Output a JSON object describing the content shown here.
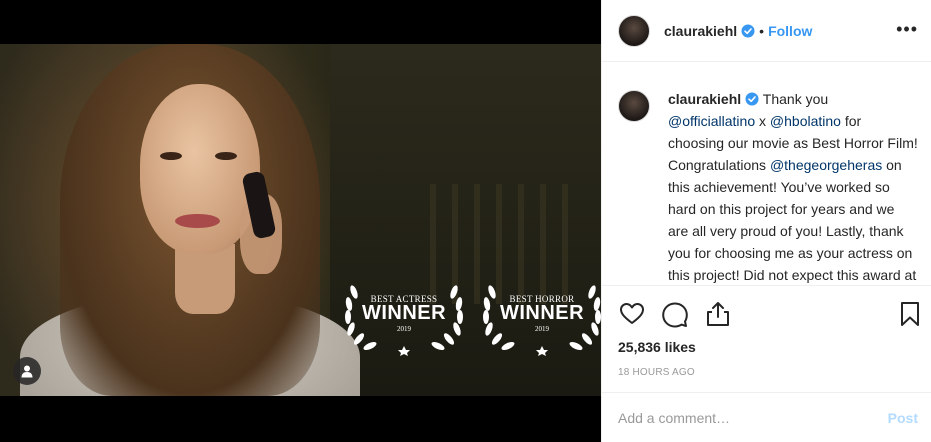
{
  "post": {
    "username": "claurakiehl",
    "follow_label": "Follow",
    "dot": "•",
    "more_label": "•••"
  },
  "media": {
    "badges": [
      {
        "sub": "BEST ACTRESS",
        "title": "WINNER",
        "year": "2019"
      },
      {
        "sub": "BEST HORROR",
        "title": "WINNER",
        "year": "2019"
      }
    ]
  },
  "caption": {
    "username": "claurakiehl",
    "t1": " Thank you ",
    "m1": "@officiallatino",
    "t2": " x ",
    "m2": "@hbolatino",
    "t3": " for choosing our movie as Best Horror Film! Congratulations ",
    "m3": "@thegeorgeheras",
    "t4": " on this achievement! You’ve worked so hard on this project for years and we are all very proud of you! Lastly, thank you for choosing me as your actress on this project! Did not expect this award at all! ",
    "emoji": "🙏"
  },
  "likes": "25,836 likes",
  "timestamp": "18 HOURS AGO",
  "comment_box": {
    "placeholder": "Add a comment…",
    "post_label": "Post"
  },
  "colors": {
    "accent": "#3897f0",
    "mention": "#003569",
    "post_disabled": "#b3dbff",
    "muted": "#999999"
  }
}
